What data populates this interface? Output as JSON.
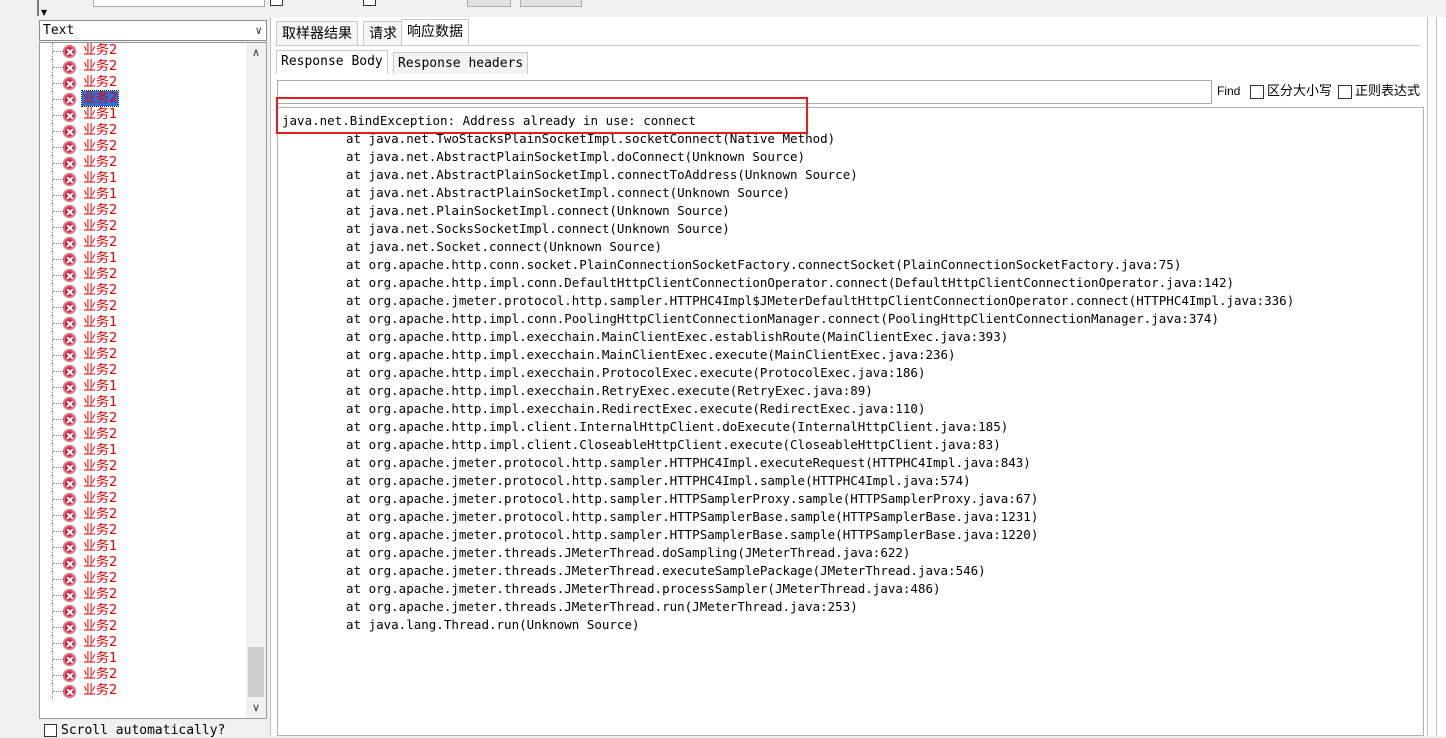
{
  "renderer": {
    "selected": "Text"
  },
  "tree": {
    "items": [
      {
        "label": "业务2"
      },
      {
        "label": "业务2"
      },
      {
        "label": "业务2"
      },
      {
        "label": "业务2",
        "selected": true
      },
      {
        "label": "业务1"
      },
      {
        "label": "业务2"
      },
      {
        "label": "业务2"
      },
      {
        "label": "业务2"
      },
      {
        "label": "业务1"
      },
      {
        "label": "业务1"
      },
      {
        "label": "业务2"
      },
      {
        "label": "业务2"
      },
      {
        "label": "业务2"
      },
      {
        "label": "业务1"
      },
      {
        "label": "业务2"
      },
      {
        "label": "业务2"
      },
      {
        "label": "业务2"
      },
      {
        "label": "业务1"
      },
      {
        "label": "业务2"
      },
      {
        "label": "业务2"
      },
      {
        "label": "业务2"
      },
      {
        "label": "业务1"
      },
      {
        "label": "业务1"
      },
      {
        "label": "业务2"
      },
      {
        "label": "业务2"
      },
      {
        "label": "业务1"
      },
      {
        "label": "业务2"
      },
      {
        "label": "业务2"
      },
      {
        "label": "业务2"
      },
      {
        "label": "业务2"
      },
      {
        "label": "业务2"
      },
      {
        "label": "业务1"
      },
      {
        "label": "业务2"
      },
      {
        "label": "业务2"
      },
      {
        "label": "业务2"
      },
      {
        "label": "业务2"
      },
      {
        "label": "业务2"
      },
      {
        "label": "业务2"
      },
      {
        "label": "业务1"
      },
      {
        "label": "业务2"
      },
      {
        "label": "业务2"
      }
    ]
  },
  "scroll_auto": {
    "label": "Scroll automatically?"
  },
  "tabs": {
    "sampler_result": "取样器结果",
    "request": "请求",
    "response_data": "响应数据"
  },
  "subtabs": {
    "response_body": "Response Body",
    "response_headers": "Response headers"
  },
  "find": {
    "label": "Find",
    "case_sensitive": "区分大小写",
    "regex": "正则表达式"
  },
  "response": {
    "exception_line": "java.net.BindException: Address already in use: connect",
    "stack": [
      "\tat java.net.TwoStacksPlainSocketImpl.socketConnect(Native Method)",
      "\tat java.net.AbstractPlainSocketImpl.doConnect(Unknown Source)",
      "\tat java.net.AbstractPlainSocketImpl.connectToAddress(Unknown Source)",
      "\tat java.net.AbstractPlainSocketImpl.connect(Unknown Source)",
      "\tat java.net.PlainSocketImpl.connect(Unknown Source)",
      "\tat java.net.SocksSocketImpl.connect(Unknown Source)",
      "\tat java.net.Socket.connect(Unknown Source)",
      "\tat org.apache.http.conn.socket.PlainConnectionSocketFactory.connectSocket(PlainConnectionSocketFactory.java:75)",
      "\tat org.apache.http.impl.conn.DefaultHttpClientConnectionOperator.connect(DefaultHttpClientConnectionOperator.java:142)",
      "\tat org.apache.jmeter.protocol.http.sampler.HTTPHC4Impl$JMeterDefaultHttpClientConnectionOperator.connect(HTTPHC4Impl.java:336)",
      "\tat org.apache.http.impl.conn.PoolingHttpClientConnectionManager.connect(PoolingHttpClientConnectionManager.java:374)",
      "\tat org.apache.http.impl.execchain.MainClientExec.establishRoute(MainClientExec.java:393)",
      "\tat org.apache.http.impl.execchain.MainClientExec.execute(MainClientExec.java:236)",
      "\tat org.apache.http.impl.execchain.ProtocolExec.execute(ProtocolExec.java:186)",
      "\tat org.apache.http.impl.execchain.RetryExec.execute(RetryExec.java:89)",
      "\tat org.apache.http.impl.execchain.RedirectExec.execute(RedirectExec.java:110)",
      "\tat org.apache.http.impl.client.InternalHttpClient.doExecute(InternalHttpClient.java:185)",
      "\tat org.apache.http.impl.client.CloseableHttpClient.execute(CloseableHttpClient.java:83)",
      "\tat org.apache.jmeter.protocol.http.sampler.HTTPHC4Impl.executeRequest(HTTPHC4Impl.java:843)",
      "\tat org.apache.jmeter.protocol.http.sampler.HTTPHC4Impl.sample(HTTPHC4Impl.java:574)",
      "\tat org.apache.jmeter.protocol.http.sampler.HTTPSamplerProxy.sample(HTTPSamplerProxy.java:67)",
      "\tat org.apache.jmeter.protocol.http.sampler.HTTPSamplerBase.sample(HTTPSamplerBase.java:1231)",
      "\tat org.apache.jmeter.protocol.http.sampler.HTTPSamplerBase.sample(HTTPSamplerBase.java:1220)",
      "\tat org.apache.jmeter.threads.JMeterThread.doSampling(JMeterThread.java:622)",
      "\tat org.apache.jmeter.threads.JMeterThread.executeSamplePackage(JMeterThread.java:546)",
      "\tat org.apache.jmeter.threads.JMeterThread.processSampler(JMeterThread.java:486)",
      "\tat org.apache.jmeter.threads.JMeterThread.run(JMeterThread.java:253)",
      "\tat java.lang.Thread.run(Unknown Source)"
    ]
  },
  "colors": {
    "error_red": "#e00000",
    "selection_blue": "#2f6fd6",
    "highlight_red": "#e41c1c"
  }
}
